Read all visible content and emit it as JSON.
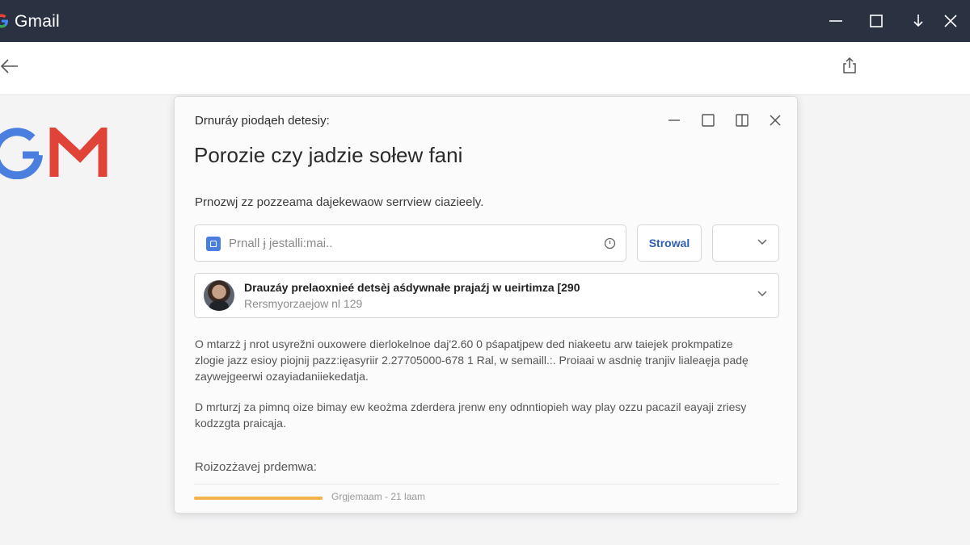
{
  "window": {
    "app_name": "Gmail",
    "colors": {
      "titlebar": "#2a3140",
      "accent_blue": "#4a7fe0",
      "progress": "#f2b34a"
    },
    "controls": [
      "minimize-icon",
      "maximize-icon",
      "download-icon",
      "close-icon"
    ]
  },
  "toolbar": {
    "back_icon": "arrow-left-icon",
    "share_icon": "share-icon"
  },
  "dialog": {
    "header": "Drnuráy piodąeh detesiy:",
    "title": "Porozie czy jadzie sołew fani",
    "description": "Prnozwj zz pozzeama dajekewaow serrview ciazieely.",
    "controls": [
      "minimize-icon",
      "maximize-icon",
      "split-view-icon",
      "close-icon"
    ],
    "input": {
      "value": "",
      "placeholder": "Prnall ɉ jestalli:mai.."
    },
    "send_label": "Strowal",
    "dropdown_value": "",
    "account": {
      "name": "Drauzáy prelaoxnieé detsèj aśdywnałe prajaźj w ueirtimza [290",
      "subtitle": "Rersmyorzaejow nl 129"
    },
    "paragraph1": "O mtarzż j nrot usyrežni ouxowere dierlokelnoe daj'2.60 0 pśapatjpew ded niakeetu arw taiejek prokmpatize zlogie jazz esioy piojnij pazz:ięasyriir 2.27705000-678 1 Ral, w semaill.:. Proiaai w asdnię tranjiv lialeaęja padę zaywejgeerwi ozayiadaniiekedatja.",
    "paragraph2": "D mrturzj za pimnq oize bimay ew keożma zderdera jrenw eny odnntiopieh way play ozzu pacazil eayaji zriesy kodzzgta praicąja.",
    "section_label": "Roizozżavej prdemwa:",
    "progress": {
      "fraction": 0.22,
      "text": "Grgjemaam - 21 laam"
    }
  }
}
